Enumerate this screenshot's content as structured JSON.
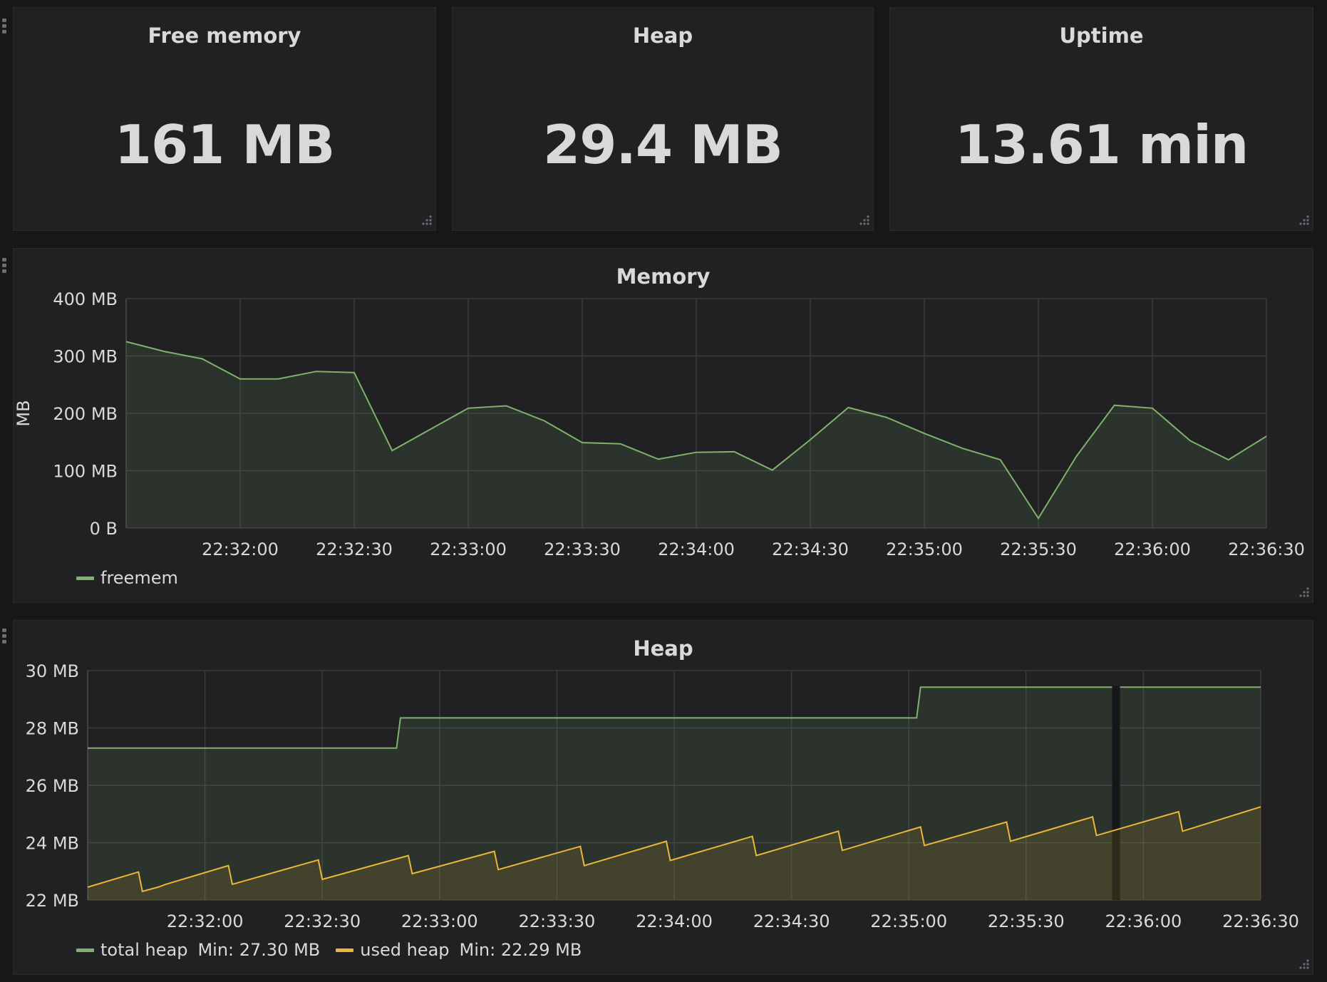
{
  "stats": [
    {
      "title": "Free memory",
      "value": "161 MB"
    },
    {
      "title": "Heap",
      "value": "29.4 MB"
    },
    {
      "title": "Uptime",
      "value": "13.61 min"
    }
  ],
  "icons": {
    "drag": "drag-handle-icon",
    "resize": "resize-corner-icon"
  },
  "colors": {
    "background": "#161719",
    "panel": "#212124",
    "green": "#7eb26d",
    "yellow": "#eab839",
    "grid": "#3a3b3e",
    "text": "#d8d9da"
  },
  "chart_data": [
    {
      "type": "area",
      "title": "Memory",
      "ylabel": "MB",
      "ylim": [
        0,
        400
      ],
      "yticks": [
        0,
        100,
        200,
        300,
        400
      ],
      "ytick_labels": [
        "0 B",
        "100 MB",
        "200 MB",
        "300 MB",
        "400 MB"
      ],
      "xlim": [
        "22:31:30",
        "22:36:30"
      ],
      "xtick_labels": [
        "22:32:00",
        "22:32:30",
        "22:33:00",
        "22:33:30",
        "22:34:00",
        "22:34:30",
        "22:35:00",
        "22:35:30",
        "22:36:00",
        "22:36:30"
      ],
      "grid": true,
      "legend": "bottom-left",
      "series": [
        {
          "name": "freemem",
          "color": "#7eb26d",
          "x": [
            "22:31:30",
            "22:31:40",
            "22:31:50",
            "22:32:00",
            "22:32:10",
            "22:32:20",
            "22:32:30",
            "22:32:40",
            "22:32:50",
            "22:33:00",
            "22:33:10",
            "22:33:20",
            "22:33:30",
            "22:33:40",
            "22:33:50",
            "22:34:00",
            "22:34:10",
            "22:34:20",
            "22:34:30",
            "22:34:40",
            "22:34:50",
            "22:35:00",
            "22:35:10",
            "22:35:20",
            "22:35:30",
            "22:35:40",
            "22:35:50",
            "22:36:00",
            "22:36:10",
            "22:36:20",
            "22:36:30"
          ],
          "values": [
            325,
            308,
            295,
            260,
            260,
            273,
            271,
            135,
            172,
            209,
            213,
            187,
            149,
            147,
            120,
            132,
            133,
            101,
            154,
            210,
            193,
            165,
            139,
            119,
            17,
            125,
            214,
            209,
            152,
            119,
            160
          ]
        }
      ]
    },
    {
      "type": "area",
      "title": "Heap",
      "ylim": [
        22,
        30
      ],
      "yticks": [
        22,
        24,
        26,
        28,
        30
      ],
      "ytick_labels": [
        "22 MB",
        "24 MB",
        "26 MB",
        "28 MB",
        "30 MB"
      ],
      "xlim": [
        "22:31:30",
        "22:36:30"
      ],
      "xtick_labels": [
        "22:32:00",
        "22:32:30",
        "22:33:00",
        "22:33:30",
        "22:34:00",
        "22:34:30",
        "22:35:00",
        "22:35:30",
        "22:36:00",
        "22:36:30"
      ],
      "grid": true,
      "legend": "bottom-left",
      "series": [
        {
          "name": "total heap",
          "min_label": "Min: 27.30 MB",
          "color": "#7eb26d",
          "x": [
            "22:31:30",
            "22:32:49",
            "22:32:50",
            "22:35:02",
            "22:35:03",
            "22:35:52",
            "22:35:54",
            "22:36:30"
          ],
          "values": [
            27.3,
            27.3,
            28.35,
            28.35,
            29.42,
            29.42,
            29.42,
            29.42
          ],
          "gap": [
            "22:35:52",
            "22:35:54"
          ]
        },
        {
          "name": "used heap",
          "min_label": "Min: 22.29 MB",
          "color": "#eab839",
          "x": [
            "22:31:30",
            "22:31:43",
            "22:31:44",
            "22:31:48",
            "22:31:50",
            "22:32:06",
            "22:32:07",
            "22:32:29",
            "22:32:30",
            "22:32:52",
            "22:32:53",
            "22:33:14",
            "22:33:15",
            "22:33:36",
            "22:33:37",
            "22:33:58",
            "22:33:59",
            "22:34:20",
            "22:34:21",
            "22:34:42",
            "22:34:43",
            "22:35:03",
            "22:35:04",
            "22:35:25",
            "22:35:26",
            "22:35:47",
            "22:35:48",
            "22:36:09",
            "22:36:10",
            "22:36:30"
          ],
          "values": [
            22.45,
            22.98,
            22.3,
            22.45,
            22.55,
            23.2,
            22.55,
            23.4,
            22.72,
            23.55,
            22.92,
            23.7,
            23.06,
            23.87,
            23.2,
            24.05,
            23.38,
            24.22,
            23.55,
            24.4,
            23.73,
            24.55,
            23.9,
            24.72,
            24.05,
            24.9,
            24.25,
            25.08,
            24.4,
            25.25
          ]
        }
      ]
    }
  ]
}
